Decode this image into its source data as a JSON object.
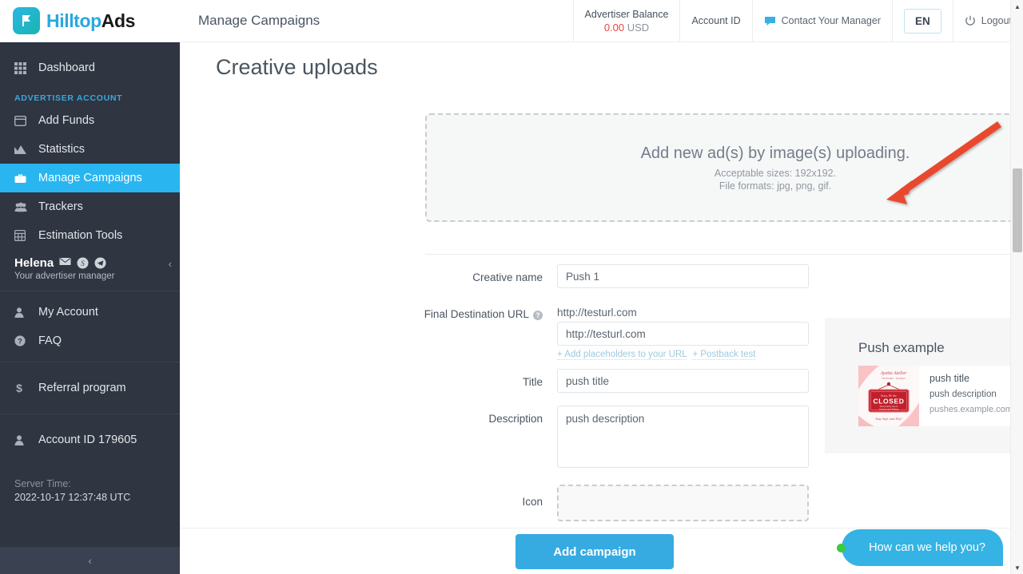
{
  "brand": {
    "name_part1": "Hilltop",
    "name_part2": "Ads",
    "accent": "#29a8e0",
    "sidebar_bg": "#2f3541",
    "active_bg": "#29b6f0"
  },
  "sidebar": {
    "dashboard": {
      "label": "Dashboard",
      "icon": "grid-icon"
    },
    "section_title": "ADVERTISER ACCOUNT",
    "items": [
      {
        "label": "Add Funds",
        "icon": "credit-card-icon",
        "active": false
      },
      {
        "label": "Statistics",
        "icon": "chart-area-icon",
        "active": false
      },
      {
        "label": "Manage Campaigns",
        "icon": "briefcase-icon",
        "active": true
      },
      {
        "label": "Trackers",
        "icon": "users-icon",
        "active": false
      },
      {
        "label": "Estimation Tools",
        "icon": "calculator-icon",
        "active": false
      }
    ],
    "manager": {
      "name": "Helena",
      "subtitle": "Your advertiser manager",
      "icons": [
        "mail-icon",
        "skype-icon",
        "telegram-icon"
      ],
      "collapse": "‹"
    },
    "account_items": [
      {
        "label": "My Account",
        "icon": "user-icon"
      },
      {
        "label": "FAQ",
        "icon": "question-circle-icon"
      }
    ],
    "referral": {
      "label": "Referral program",
      "icon": "dollar-icon"
    },
    "account_id": {
      "label": "Account ID 179605",
      "icon": "user-icon"
    },
    "server_time": {
      "label": "Server Time:",
      "value": "2022-10-17 12:37:48 UTC"
    },
    "footer_collapse": "‹"
  },
  "header": {
    "page_heading": "Manage Campaigns",
    "balance_label": "Advertiser Balance",
    "balance_amount": "0.00",
    "balance_currency": "USD",
    "account_id_label": "Account ID",
    "contact_manager": "Contact Your Manager",
    "contact_icon": "chat-bubble-icon",
    "language": "EN",
    "logout": "Logout",
    "logout_icon": "power-icon"
  },
  "main": {
    "page_title": "Creative uploads",
    "dropzone": {
      "title": "Add new ad(s) by image(s) uploading.",
      "sizes": "Acceptable sizes: 192x192.",
      "formats": "File formats: jpg, png, gif."
    },
    "annotation": {
      "type": "red-arrow",
      "color": "#e8482f"
    },
    "form": {
      "creative_name": {
        "label": "Creative name",
        "value": "Push 1",
        "placeholder": "Creative name"
      },
      "final_url": {
        "label": "Final Destination URL",
        "help": "?",
        "echo": "http://testurl.com",
        "value": "http://testurl.com",
        "placeholder": "http://",
        "link_placeholders": "+ Add placeholders to your URL",
        "link_postback": "+ Postback test"
      },
      "title": {
        "label": "Title",
        "value": "push title",
        "placeholder": "Title"
      },
      "description": {
        "label": "Description",
        "value": "push description",
        "placeholder": "Description"
      },
      "icon": {
        "label": "Icon"
      }
    },
    "preview": {
      "title": "Push example",
      "push_title": "push title",
      "push_description": "push description",
      "push_domain": "pushes.example.com",
      "thumb_alt": "closed-sign-image",
      "gear_icon": "gear-icon",
      "close_icon": "close-icon"
    }
  },
  "bottom": {
    "add_campaign": "Add campaign",
    "help_widget": "How can we help you?",
    "help_status": "online"
  },
  "scrollbar": {
    "up": "▲",
    "down": "▼"
  }
}
